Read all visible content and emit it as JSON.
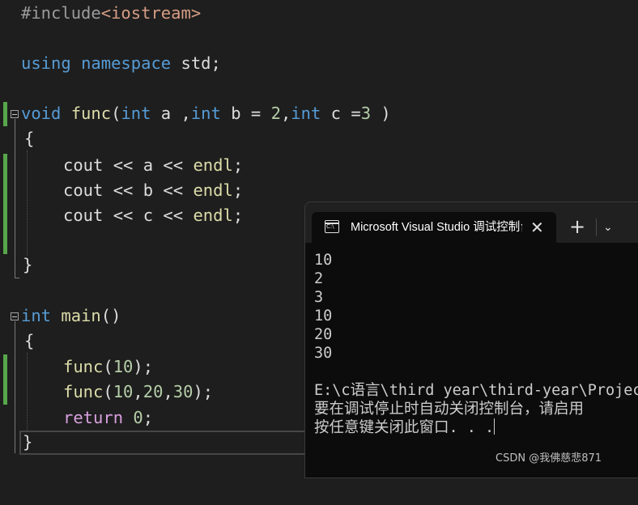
{
  "editor": {
    "line1": {
      "directive": "#include",
      "header": "<iostream>"
    },
    "line2": {
      "kw_using": "using",
      "kw_namespace": "namespace",
      "rest": " std;"
    },
    "line3": {
      "kw_void": "void",
      "name": "func",
      "p1": "(",
      "t1": "int",
      "a": " a ,",
      "t2": "int",
      "b": " b = ",
      "n2": "2",
      "comma": ",",
      "t3": "int",
      "c": " c =",
      "n3": "3",
      "close": " )"
    },
    "open_brace": "{",
    "cout_a": {
      "cout": "cout",
      "rest": " << a << ",
      "endl": "endl",
      "semi": ";"
    },
    "cout_b": {
      "cout": "cout",
      "rest": " << b << ",
      "endl": "endl",
      "semi": ";"
    },
    "cout_c": {
      "cout": "cout",
      "rest": " << c << ",
      "endl": "endl",
      "semi": ";"
    },
    "close_brace": "}",
    "main_sig": {
      "kw_int": "int",
      "name": "main",
      "parens": "()"
    },
    "call1": {
      "name": "func",
      "open": "(",
      "arg": "10",
      "close": ");"
    },
    "call2": {
      "name": "func",
      "open": "(",
      "a1": "10",
      "c1": ",",
      "a2": "20",
      "c2": ",",
      "a3": "30",
      "close": ");"
    },
    "ret": {
      "kw": "return",
      "val": "0",
      "semi": ";"
    }
  },
  "terminal": {
    "tab_title": "Microsoft Visual Studio 调试控制台",
    "tab_close_icon": "close-icon",
    "new_tab_icon": "plus-icon",
    "dropdown_icon": "chevron-down-icon",
    "output_lines": [
      "10",
      "2",
      "3",
      "10",
      "20",
      "30",
      "",
      "E:\\c语言\\third year\\third-year\\Project",
      "要在调试停止时自动关闭控制台，请启用",
      "按任意键关闭此窗口. . ."
    ]
  },
  "watermark": "CSDN @我佛慈悲871",
  "colors": {
    "keyword": "#569cd6",
    "function": "#dcdcaa",
    "number": "#b5cea8",
    "string": "#d69d85",
    "control": "#d8a0df",
    "change_bar": "#57a64a"
  }
}
